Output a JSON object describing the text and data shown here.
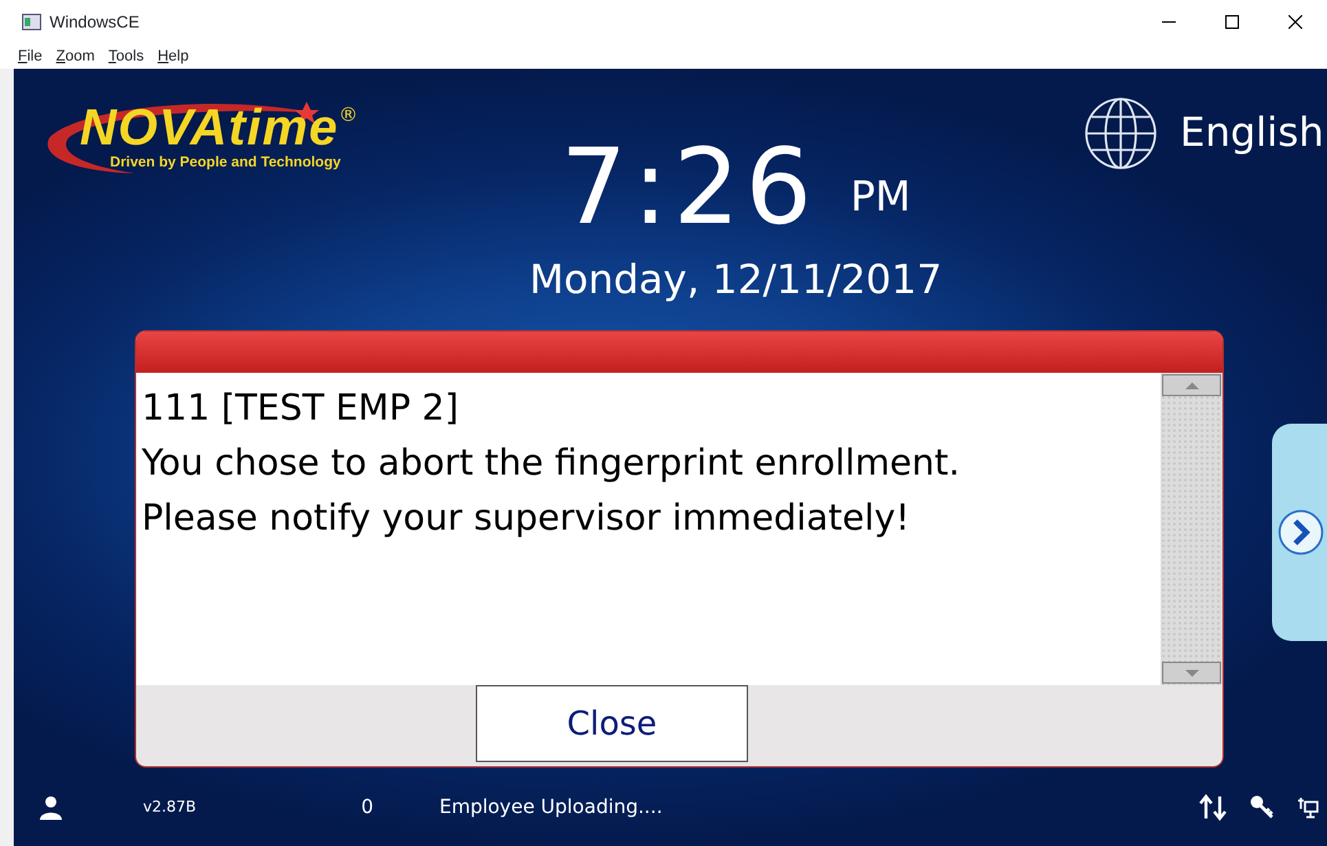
{
  "window": {
    "title": "WindowsCE"
  },
  "menu": [
    {
      "label": "File"
    },
    {
      "label": "Zoom"
    },
    {
      "label": "Tools"
    },
    {
      "label": "Help"
    }
  ],
  "logo": {
    "brand": "NOVAtime",
    "registered": "®",
    "tagline": "Driven by People and Technology"
  },
  "language": {
    "label": "English"
  },
  "clock": {
    "time": "7:26",
    "meridiem": "PM",
    "date": "Monday, 12/11/2017"
  },
  "dialog": {
    "lines": [
      "111 [TEST EMP 2]",
      "You chose to abort the fingerprint enrollment.",
      "Please notify your supervisor immediately!"
    ],
    "button": "Close"
  },
  "status_bar": {
    "version": "v2.87B",
    "count": "0",
    "message": "Employee Uploading...."
  }
}
